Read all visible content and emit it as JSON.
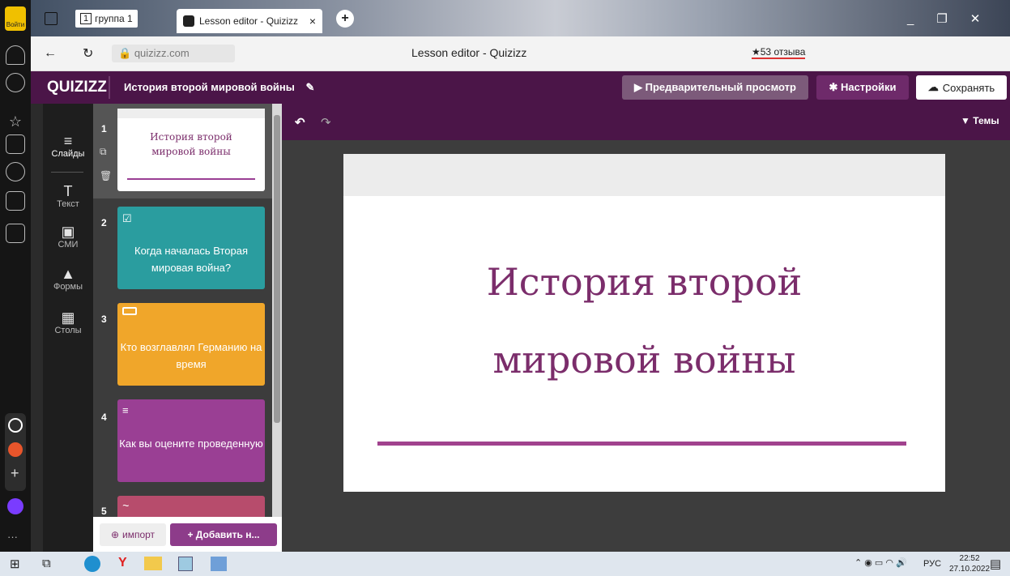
{
  "browser": {
    "profile_label": "Войти",
    "group_tab": "группа 1",
    "group_count": "1",
    "active_tab": "Lesson editor - Quizizz",
    "address": "quizizz.com",
    "page_title": "Lesson editor - Quizizz",
    "reviews": "★53 отзыва"
  },
  "app": {
    "logo": "QUIZIZZ",
    "lesson_title": "История второй мировой войны",
    "preview_btn": "▶ Предварительный просмотр",
    "settings_btn": "✱ Настройки",
    "save_btn": "Сохранять",
    "themes_btn": "Темы"
  },
  "tools": [
    {
      "label": "Слайды",
      "icon": "slides-icon"
    },
    {
      "label": "Текст",
      "icon": "text-icon"
    },
    {
      "label": "СМИ",
      "icon": "media-icon"
    },
    {
      "label": "Формы",
      "icon": "shapes-icon"
    },
    {
      "label": "Столы",
      "icon": "tables-icon"
    }
  ],
  "slides": [
    {
      "num": "1",
      "text": "История второй мировой войны",
      "color": "#ffffff"
    },
    {
      "num": "2",
      "text": "Когда началась Вторая мировая война?",
      "color": "#2a9d9f"
    },
    {
      "num": "3",
      "text": "Кто возглавлял Германию на время",
      "color": "#f0a62a"
    },
    {
      "num": "4",
      "text": "Как вы оцените проведенную",
      "color": "#9a3f94"
    },
    {
      "num": "5",
      "text": "",
      "color": "#b74c6c"
    }
  ],
  "slide_main": {
    "title_line1": "История второй",
    "title_line2": "мировой войны"
  },
  "bottom": {
    "import_btn": "импорт",
    "add_btn": "+ Добавить н..."
  },
  "taskbar": {
    "lang": "РУС",
    "time": "22:52",
    "date": "27.10.2022"
  }
}
